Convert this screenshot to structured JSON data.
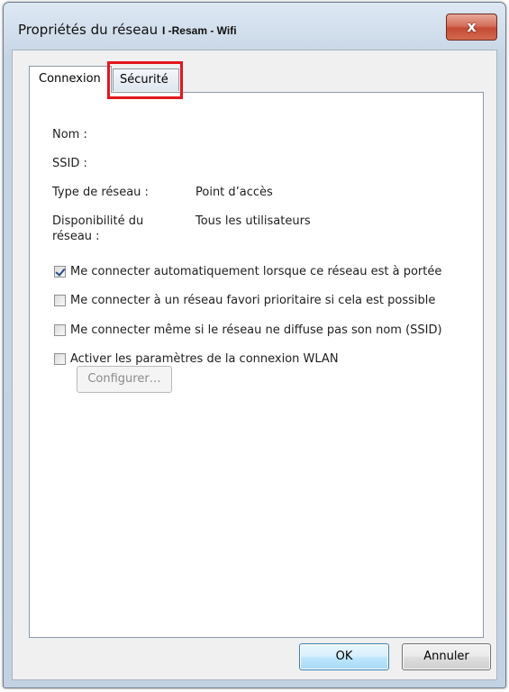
{
  "window": {
    "title": "Propriétés du réseau",
    "network_name": "I -Resam - Wifi",
    "close_label": "x"
  },
  "tabs": [
    {
      "label": "Connexion",
      "active": true
    },
    {
      "label": "Sécurité",
      "active": false,
      "highlighted": true
    }
  ],
  "properties": [
    {
      "label": "Nom :",
      "value": ""
    },
    {
      "label": "SSID :",
      "value": ""
    },
    {
      "label": "Type de réseau :",
      "value": "Point d’accès"
    },
    {
      "label_line1": "Disponibilité du",
      "label_line2": "réseau :",
      "value": "Tous les utilisateurs"
    }
  ],
  "options": [
    {
      "label": "Me connecter automatiquement lorsque ce réseau est à portée",
      "checked": true
    },
    {
      "label": "Me connecter à un réseau favori prioritaire si cela est possible",
      "checked": false
    },
    {
      "label": "Me connecter même si le réseau ne diffuse pas son nom (SSID)",
      "checked": false
    },
    {
      "label": "Activer les paramètres de la connexion WLAN",
      "checked": false
    }
  ],
  "configure_label": "Configurer…",
  "buttons": {
    "ok": "OK",
    "cancel": "Annuler"
  },
  "colors": {
    "highlight": "#e2161f",
    "close_button": "#c44b35",
    "window_frame": "#c6d5e4"
  }
}
